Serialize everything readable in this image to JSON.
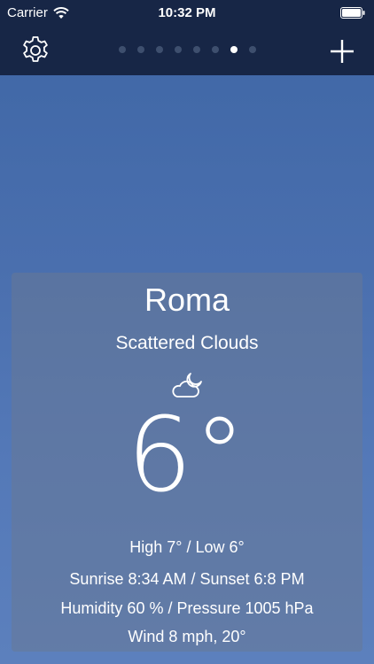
{
  "status_bar": {
    "carrier": "Carrier",
    "time": "10:32 PM"
  },
  "nav": {
    "settings_icon": "gear-icon",
    "add_icon": "plus-icon",
    "page_dots": {
      "count": 8,
      "active_index": 6
    }
  },
  "weather": {
    "city": "Roma",
    "condition": "Scattered Clouds",
    "condition_icon": "cloud-moon-icon",
    "temperature": "6°",
    "high_low": "High 7° / Low 6°",
    "sun": "Sunrise 8:34 AM / Sunset 6:8 PM",
    "humidity_pressure": "Humidity 60 % / Pressure 1005 hPa",
    "wind": "Wind 8 mph, 20°"
  },
  "colors": {
    "bar": "#172646",
    "background_top": "#3e66a5",
    "background_bottom": "#5c80bd",
    "card": "#687896",
    "text": "#ffffff"
  }
}
